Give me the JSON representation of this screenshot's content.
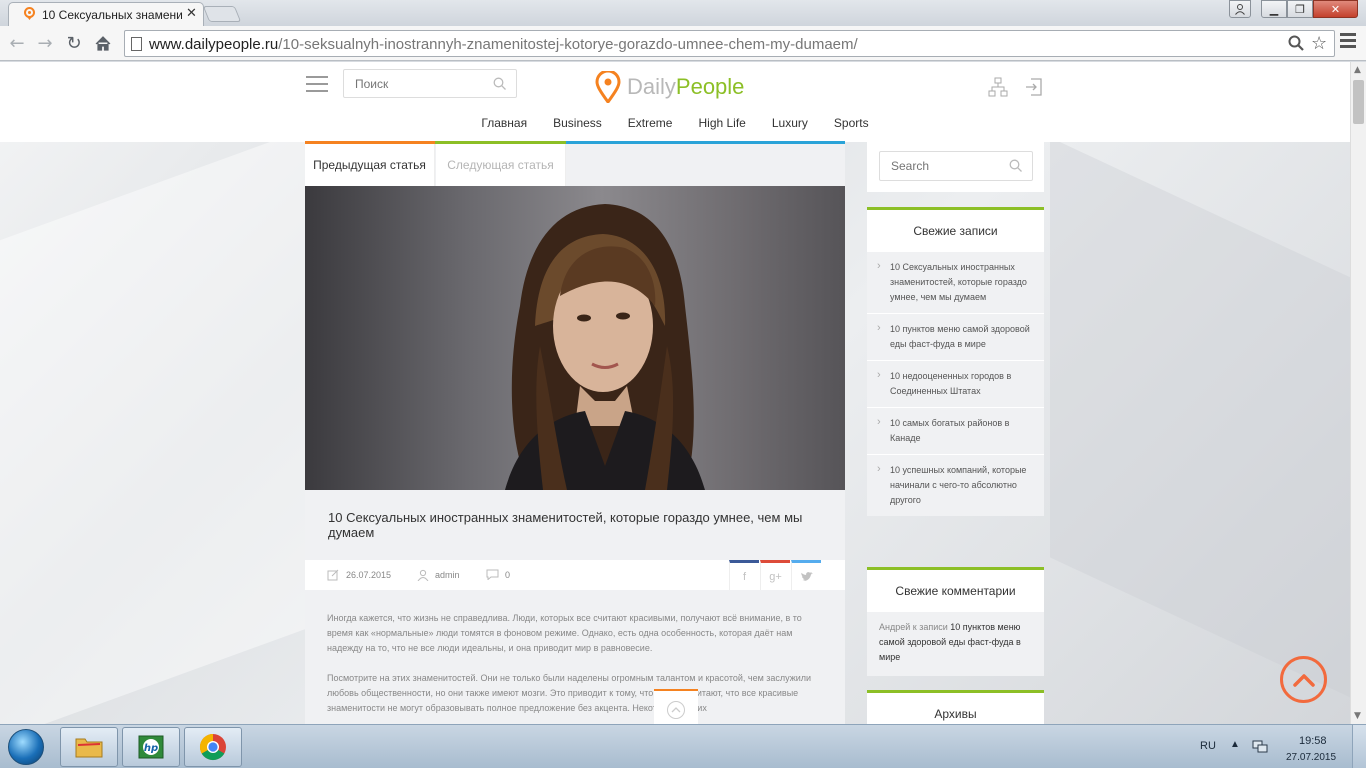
{
  "browser": {
    "tab_title": "10 Сексуальных знамени",
    "url_host": "www.dailypeople.ru",
    "url_path": "/10-seksualnyh-inostrannyh-znamenitostej-kotorye-gorazdo-umnee-chem-my-dumaem/"
  },
  "header": {
    "search_placeholder": "Поиск",
    "logo_part1": "Daily",
    "logo_part2": "People",
    "logo_colors": {
      "grey": "#b8b8b8",
      "green": "#8cbf26",
      "pin": "#f58220"
    }
  },
  "nav": [
    "Главная",
    "Business",
    "Extreme",
    "High Life",
    "Luxury",
    "Sports"
  ],
  "article": {
    "prev_label": "Предыдущая статья",
    "next_label": "Следующая статья",
    "title": "10 Сексуальных иностранных знаменитостей, которые гораздо умнее, чем мы думаем",
    "date": "26.07.2015",
    "author": "admin",
    "comments": "0",
    "share": {
      "facebook": "f",
      "googleplus": "g+",
      "twitter": "t"
    },
    "paragraph1": "Иногда кажется, что жизнь не справедлива. Люди, которых все считают красивыми, получают всё внимание, в то время как «нормальные» люди томятся в фоновом режиме. Однако, есть одна особенность, которая даёт нам надежду на то, что не все люди идеальны, и она приводит мир в равновесие.",
    "paragraph2": "Посмотрите на этих знаменитостей. Они не только были наделены огромным талантом и красотой, чем заслужили любовь общественности, но они также имеют мозги. Это приводит к тому, что многие считают, что все красивые знаменитости не могут образовывать полное предложение без акцента. Некоторые из них"
  },
  "sidebar": {
    "search_placeholder": "Search",
    "recent_posts_title": "Свежие записи",
    "recent_posts": [
      "10 Сексуальных иностранных знаменитостей, которые гораздо умнее, чем мы думаем",
      "10 пунктов меню самой здоровой еды фаст-фуда в мире",
      "10 недооцененных городов в Соединенных Штатах",
      "10 самых богатых районов в Канаде",
      "10 успешных компаний, которые начинали с чего-то абсолютно другого"
    ],
    "recent_comments_title": "Свежие комментарии",
    "comment_author": "Андрей",
    "comment_connector": "к записи",
    "comment_link": "10 пунктов меню самой здоровой еды фаст-фуда в мире",
    "archives_title": "Архивы"
  },
  "taskbar": {
    "language": "RU",
    "time": "19:58",
    "date": "27.07.2015"
  }
}
